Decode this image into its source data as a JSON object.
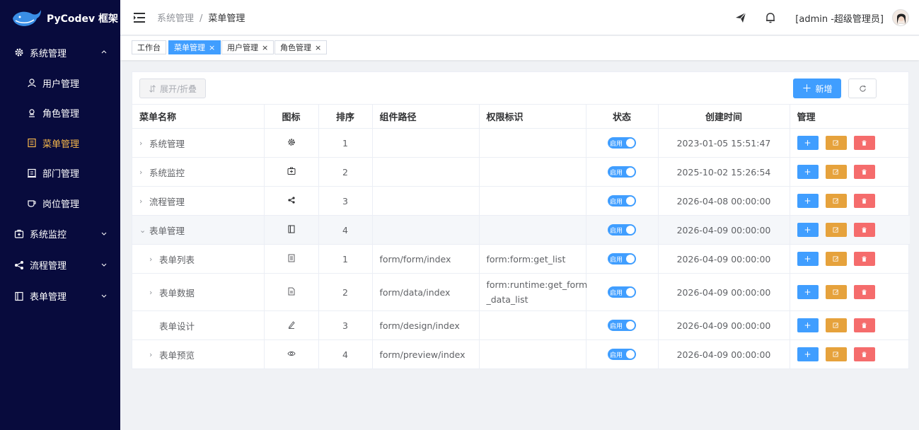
{
  "app": {
    "title": "PyCodev 框架"
  },
  "sidebar": {
    "groups": [
      {
        "label": "系统管理",
        "icon": "gear-icon",
        "expanded": true
      },
      {
        "label": "系统监控",
        "icon": "monitor-icon",
        "expanded": false
      },
      {
        "label": "流程管理",
        "icon": "share-icon",
        "expanded": false
      },
      {
        "label": "表单管理",
        "icon": "form-icon",
        "expanded": false
      }
    ],
    "items": [
      {
        "label": "用户管理",
        "icon": "user-icon"
      },
      {
        "label": "角色管理",
        "icon": "role-icon"
      },
      {
        "label": "菜单管理",
        "icon": "menu-icon",
        "active": true
      },
      {
        "label": "部门管理",
        "icon": "department-icon"
      },
      {
        "label": "岗位管理",
        "icon": "post-icon"
      }
    ]
  },
  "header": {
    "breadcrumb": [
      "系统管理",
      "菜单管理"
    ],
    "separator": "/",
    "user": "[admin -超级管理员]"
  },
  "tags": [
    {
      "label": "工作台",
      "closable": false,
      "active": false
    },
    {
      "label": "菜单管理",
      "closable": true,
      "active": true
    },
    {
      "label": "用户管理",
      "closable": true,
      "active": false
    },
    {
      "label": "角色管理",
      "closable": true,
      "active": false
    }
  ],
  "toolbar": {
    "expand_label": "展开/折叠",
    "add_label": "新增"
  },
  "table": {
    "columns": [
      "菜单名称",
      "图标",
      "排序",
      "组件路径",
      "权限标识",
      "状态",
      "创建时间",
      "管理"
    ],
    "status_label": "启用",
    "rows": [
      {
        "name": "系统管理",
        "icon": "gear-icon",
        "sort": "1",
        "path": "",
        "perm": "",
        "created": "2023-01-05 15:51:47"
      },
      {
        "name": "系统监控",
        "icon": "monitor-icon",
        "sort": "2",
        "path": "",
        "perm": "",
        "created": "2025-10-02 15:26:54"
      },
      {
        "name": "流程管理",
        "icon": "share-icon",
        "sort": "3",
        "path": "",
        "perm": "",
        "created": "2026-04-08 00:00:00"
      },
      {
        "name": "表单管理",
        "icon": "form-icon",
        "sort": "4",
        "path": "",
        "perm": "",
        "created": "2026-04-09 00:00:00"
      },
      {
        "name": "表单列表",
        "icon": "list-icon",
        "sort": "1",
        "path": "form/form/index",
        "perm": "form:form:get_list",
        "created": "2026-04-09 00:00:00"
      },
      {
        "name": "表单数据",
        "icon": "document-icon",
        "sort": "2",
        "path": "form/data/index",
        "perm": "form:runtime:get_form_data_list",
        "perm_lines": [
          "form:runtime:get_form",
          "_data_list"
        ],
        "created": "2026-04-09 00:00:00"
      },
      {
        "name": "表单设计",
        "icon": "edit-icon",
        "sort": "3",
        "path": "form/design/index",
        "perm": "",
        "created": "2026-04-09 00:00:00"
      },
      {
        "name": "表单预览",
        "icon": "eye-icon",
        "sort": "4",
        "path": "form/preview/index",
        "perm": "",
        "created": "2026-04-09 00:00:00"
      }
    ]
  },
  "colors": {
    "sidebar_bg": "#080b3d",
    "primary": "#409eff",
    "warning": "#e6a23c",
    "danger": "#f56c6c",
    "active_menu": "#f7b84b"
  }
}
